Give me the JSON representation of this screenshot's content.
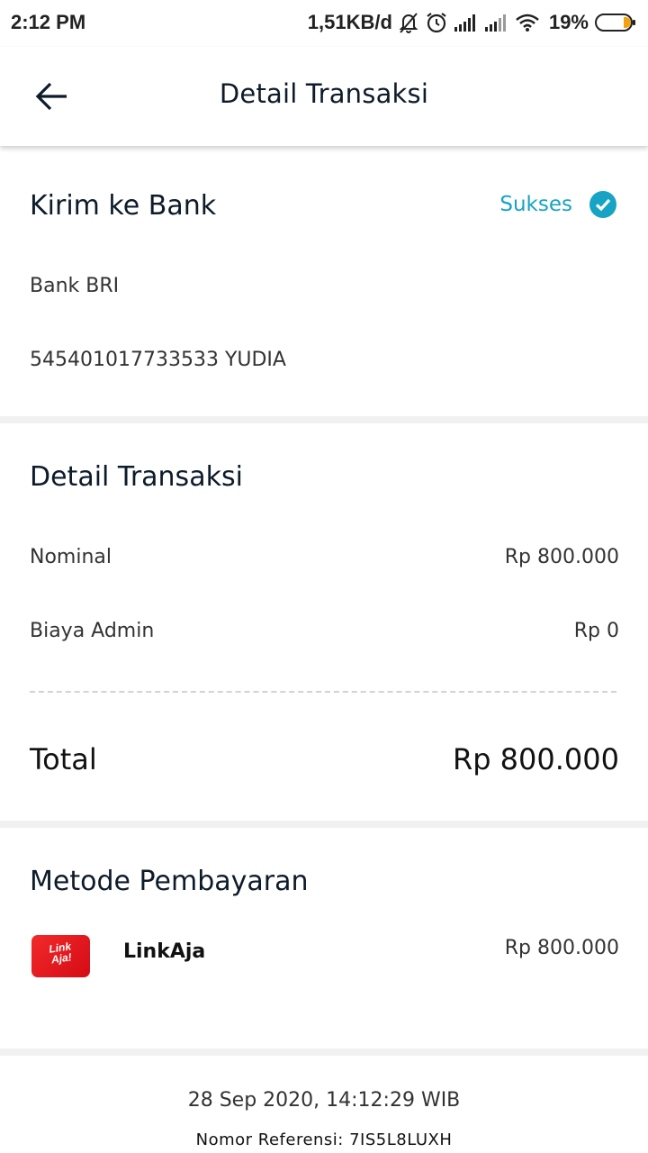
{
  "status_bar": {
    "time": "2:12 PM",
    "speed": "1,51KB/d",
    "battery": "19%",
    "icons": [
      "bell-off-icon",
      "alarm-icon",
      "signal-icon",
      "signal-icon",
      "wifi-icon",
      "battery-icon"
    ]
  },
  "app_bar": {
    "back_icon": "arrow-left-icon",
    "title": "Detail Transaksi"
  },
  "transfer": {
    "title": "Kirim ke Bank",
    "status": "Sukses",
    "status_icon": "check-circle-icon",
    "status_color": "#17a3c3",
    "bank": "Bank BRI",
    "account": "545401017733533 YUDIA"
  },
  "details": {
    "title": "Detail Transaksi",
    "nominal_label": "Nominal",
    "nominal_value": "Rp 800.000",
    "admin_label": "Biaya Admin",
    "admin_value": "Rp 0",
    "total_label": "Total",
    "total_value": "Rp 800.000"
  },
  "payment": {
    "title": "Metode Pembayaran",
    "logo_line1": "Link",
    "logo_line2": "Aja!",
    "logo_color": "#e31b23",
    "method": "LinkAja",
    "amount": "Rp 800.000"
  },
  "footer": {
    "date": "28 Sep 2020, 14:12:29 WIB",
    "reference": "Nomor Referensi: 7IS5L8LUXH"
  }
}
